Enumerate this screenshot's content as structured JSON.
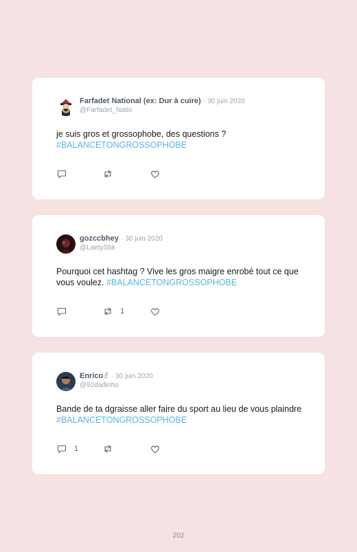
{
  "tweets": [
    {
      "name": "Farfadet National (ex: Dur à cuire)",
      "separator": "·",
      "date": "30 juin 2020",
      "handle": "@Farfadet_Natio",
      "text": "je suis gros et grossophobe, des questions ?",
      "hashtag": "#BALANCETONGROSSOPHOBE",
      "replies": "",
      "retweets": "",
      "likes": ""
    },
    {
      "name": "gozccbhey",
      "separator": "·",
      "date": "30 juin 2020",
      "handle": "@LaetySbk",
      "text": "Pourquoi cet hashtag ? Vive les gros maigre enrobé tout ce que vous voulez. ",
      "hashtag": "#BALANCETONGROSSOPHOBE",
      "replies": "",
      "retweets": "1",
      "likes": ""
    },
    {
      "name": "Enrico",
      "name_symbol": "⚦",
      "separator": "·",
      "date": "30 juin 2020",
      "handle": "@92dadinho",
      "text": "Bande de ta dgraisse aller faire du sport au lieu de vous plaindre ",
      "hashtag": "#BALANCETONGROSSOPHOBE",
      "replies": "1",
      "retweets": "",
      "likes": ""
    }
  ],
  "page_number": "202",
  "icons": {
    "reply": "reply-icon",
    "retweet": "retweet-icon",
    "like": "heart-icon"
  },
  "colors": {
    "background": "#f6e2e2",
    "card": "#ffffff",
    "hashtag": "#5ab3e0",
    "name": "#4c5966",
    "muted": "#9aa4ad"
  }
}
